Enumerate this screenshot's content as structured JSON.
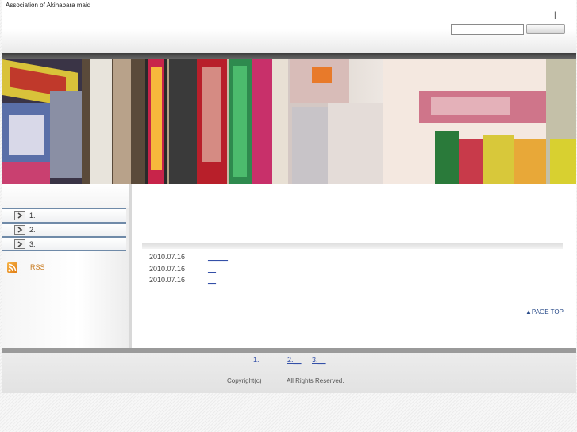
{
  "header": {
    "site_title": "Association of Akihabara maid",
    "separator": "|",
    "search": {
      "value": "",
      "placeholder": ""
    },
    "search_button_label": ""
  },
  "banner": {
    "description_icon": "akihabara-street-photo"
  },
  "sidebar": {
    "items": [
      {
        "label": "1."
      },
      {
        "label": "2."
      },
      {
        "label": "3."
      }
    ],
    "rss_label": "RSS",
    "rss_icon": "rss-icon"
  },
  "main": {
    "news": [
      {
        "date": "2010.07.16",
        "link": "_____"
      },
      {
        "date": "2010.07.16",
        "link": "__"
      },
      {
        "date": "2010.07.16",
        "link": "__"
      }
    ],
    "page_top": "▲PAGE TOP"
  },
  "footer": {
    "links": [
      {
        "label": "1."
      },
      {
        "label": "2.__"
      },
      {
        "label": "3.__"
      }
    ],
    "copyright": "Copyright(c)",
    "rights": "All Rights Reserved."
  },
  "colors": {
    "link": "#3450a8",
    "rss": "#c8791c",
    "nav_border": "#6f8aa8",
    "dark_bar": "#3c3c3c"
  }
}
